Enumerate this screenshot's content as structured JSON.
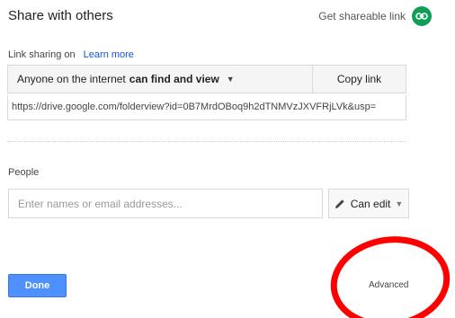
{
  "dialog": {
    "title": "Share with others",
    "get_link_label": "Get shareable link",
    "link_icon": "link-icon"
  },
  "link_sharing": {
    "status": "Link sharing on",
    "learn_more": "Learn more",
    "access_prefix": "Anyone on the internet",
    "access_level": "can find and view",
    "copy_label": "Copy link",
    "url": "https://drive.google.com/folderview?id=0B7MrdOBoq9h2dTNMVzJXVFRjLVk&usp="
  },
  "people": {
    "label": "People",
    "placeholder": "Enter names or email addresses...",
    "permission": "Can edit",
    "permission_icon": "pencil-icon"
  },
  "footer": {
    "done": "Done",
    "advanced": "Advanced"
  },
  "colors": {
    "accent": "#4d90fe",
    "link": "#1155cc",
    "link_icon_bg": "#0f9d58",
    "annotation": "#ff0000"
  }
}
